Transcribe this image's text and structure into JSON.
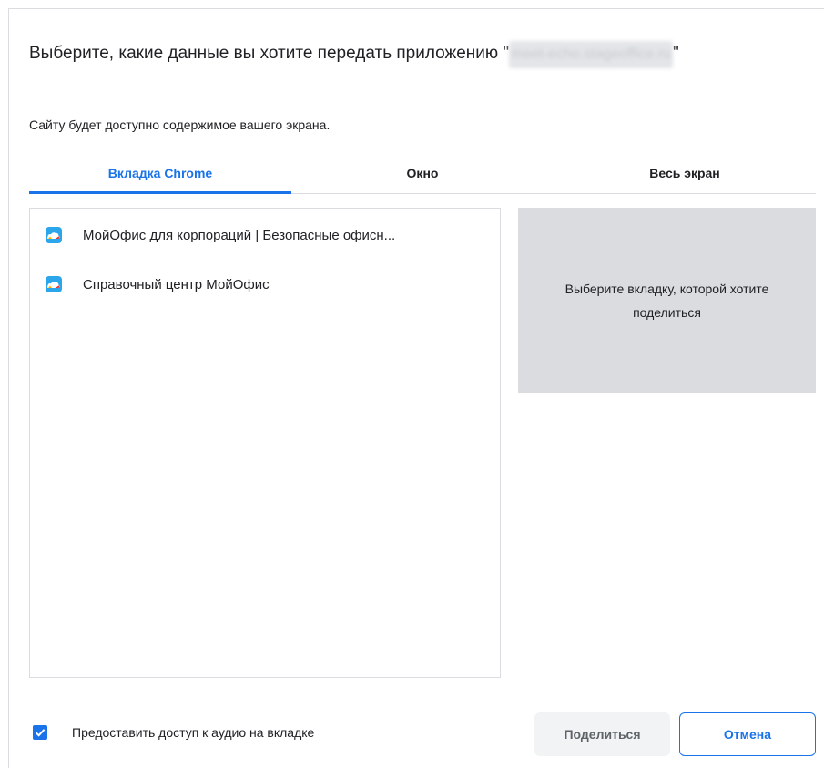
{
  "dialog": {
    "title_prefix": "Выберите, какие данные вы хотите передать приложению \"",
    "title_origin": "meet-echo.stageoffice.ru",
    "title_suffix": "\"",
    "subtitle": "Сайту будет доступно содержимое вашего экрана."
  },
  "tabs": [
    {
      "label": "Вкладка Chrome",
      "active": true
    },
    {
      "label": "Окно",
      "active": false
    },
    {
      "label": "Весь экран",
      "active": false
    }
  ],
  "tab_list": {
    "items": [
      {
        "label": "МойОфис для корпораций | Безопасные офисн...",
        "icon": "myoffice-cloud-icon"
      },
      {
        "label": "Справочный центр МойОфис",
        "icon": "myoffice-cloud-icon"
      }
    ]
  },
  "preview": {
    "placeholder": "Выберите вкладку, которой хотите поделиться"
  },
  "footer": {
    "audio_checkbox_label": "Предоставить доступ к аудио на вкладке",
    "audio_checked": true,
    "share_label": "Поделиться",
    "cancel_label": "Отмена"
  },
  "colors": {
    "accent": "#1a73e8",
    "preview_bg": "#dadce0",
    "share_button_bg": "#f1f3f4"
  }
}
